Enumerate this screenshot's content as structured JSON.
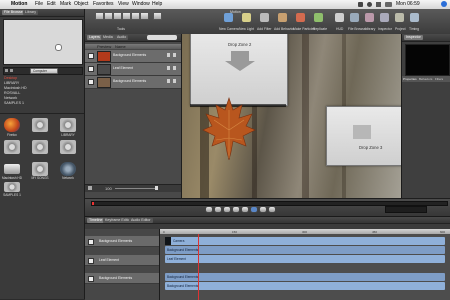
{
  "menubar": {
    "apple": "",
    "items": [
      "Motion",
      "File",
      "Edit",
      "Mark",
      "Object",
      "Favorites",
      "View",
      "Window",
      "Help"
    ],
    "clock": "Mon 06:59"
  },
  "left_panel": {
    "tabs": [
      "File Browser",
      "Library"
    ],
    "path": "Computer",
    "sources": [
      "Desktop",
      "LIBRARY",
      "Macintosh HD",
      "ROSVALL",
      "Network",
      "SAMPLES 1"
    ],
    "files": [
      {
        "label": "Firefox",
        "icon": "firefox-icon"
      },
      {
        "label": "",
        "icon": "speaker-icon"
      },
      {
        "label": "LIBRARY",
        "icon": "speaker-icon"
      },
      {
        "label": "",
        "icon": "speaker-icon"
      },
      {
        "label": "",
        "icon": "speaker-icon"
      },
      {
        "label": "",
        "icon": "speaker-icon"
      },
      {
        "label": "Macintosh HD",
        "icon": "drive-icon"
      },
      {
        "label": "MY SONGS",
        "icon": "speaker-icon"
      },
      {
        "label": "Network",
        "icon": "globe-icon"
      },
      {
        "label": "SAMPLES 1",
        "icon": "speaker-icon"
      }
    ]
  },
  "toolbar": {
    "left_label": "Tools",
    "right_labels": [
      "New Camera",
      "New Light",
      "Add Filter",
      "Add Behavior",
      "Make Particles",
      "Replicate",
      "Shape",
      "Mask",
      "HUD",
      "File Browser",
      "Library",
      "Inspector",
      "Project",
      "Timing"
    ],
    "top_labels": [
      "Motion",
      "Inspector"
    ]
  },
  "layers_panel": {
    "tabs": [
      "Layers",
      "Media",
      "Audio"
    ],
    "columns": [
      "Preview",
      "Name"
    ],
    "rows": [
      {
        "name": "Background Elements",
        "thumb": "#b23a1b"
      },
      {
        "name": "Leaf Element",
        "thumb": "#4b4b4b"
      },
      {
        "name": "Background Elements",
        "thumb": "#7a6048"
      }
    ],
    "zoom_label": "100"
  },
  "canvas": {
    "dropzones": [
      "Drop Zone 2",
      "Drop Zone 3"
    ]
  },
  "inspector": {
    "tabs": [
      "Inspector"
    ],
    "bottom_tabs": [
      "Properties",
      "Behaviors",
      "Filters"
    ]
  },
  "timeline": {
    "tabs": [
      "Timeline",
      "Keyframe Editor",
      "Audio Editor"
    ],
    "tracks": [
      "Background Elements",
      "Leaf Element",
      "Background Elements"
    ],
    "bars": [
      "Camera",
      "Background Elements",
      "Leaf Element",
      "Background Elements",
      "Background Elements"
    ],
    "ruler": [
      "0",
      "150",
      "300",
      "450",
      "600"
    ]
  },
  "colors": {
    "timeline_bar": "#8fb0d9",
    "selected_bar": "#101418"
  }
}
